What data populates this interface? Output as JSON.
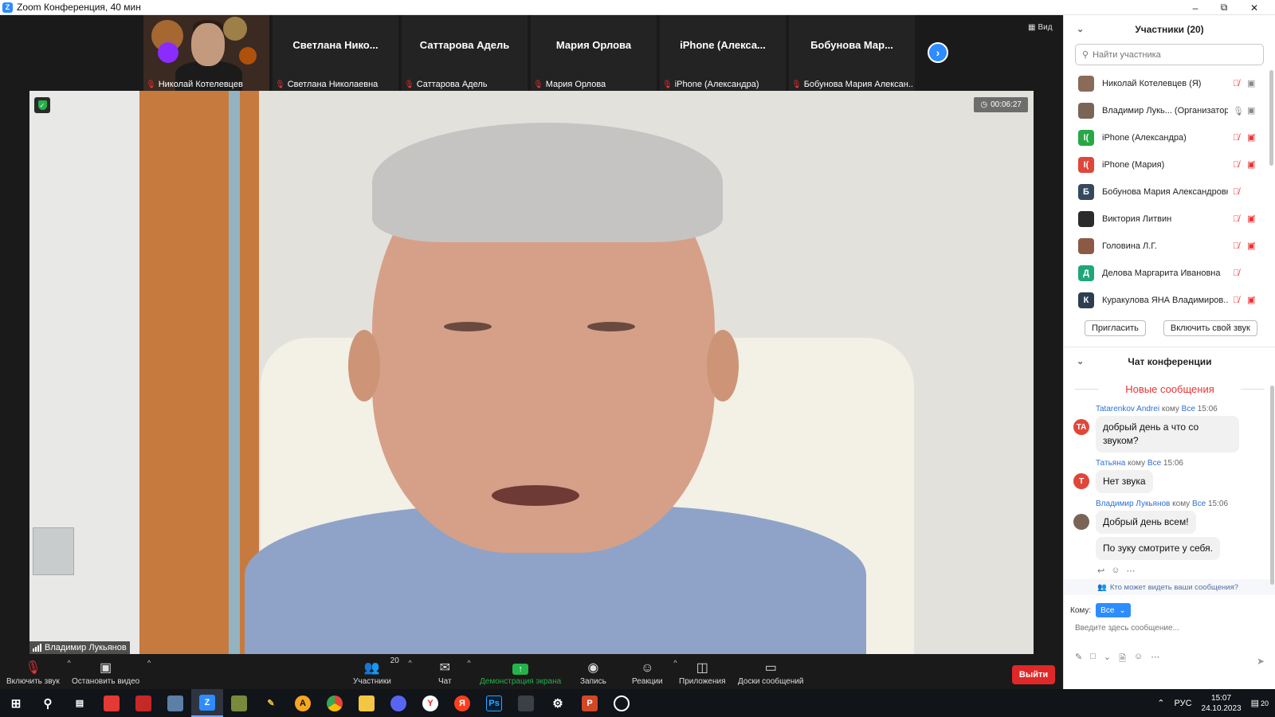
{
  "window": {
    "title": "Zoom Конференция, 40 мин",
    "logo_letter": "Z"
  },
  "thumbnails": [
    {
      "big_name": "",
      "name": "Николай Котелевцев",
      "self": true
    },
    {
      "big_name": "Светлана  Нико...",
      "name": "Светлана Николаевна"
    },
    {
      "big_name": "Саттарова Адель",
      "name": "Саттарова Адель"
    },
    {
      "big_name": "Мария Орлова",
      "name": "Мария Орлова"
    },
    {
      "big_name": "iPhone  (Алекса...",
      "name": "iPhone (Александра)"
    },
    {
      "big_name": "Бобунова  Мар...",
      "name": "Бобунова Мария Алексан..."
    }
  ],
  "view_label": "Вид",
  "main_video": {
    "timer": "00:06:27",
    "speaker": "Владимир Лукьянов"
  },
  "toolbar": {
    "unmute": "Включить звук",
    "stop_video": "Остановить видео",
    "participants": "Участники",
    "participants_count": "20",
    "chat": "Чат",
    "share": "Демонстрация экрана",
    "record": "Запись",
    "reactions": "Реакции",
    "apps": "Приложения",
    "whiteboards": "Доски сообщений",
    "leave": "Выйти"
  },
  "participants_panel": {
    "title": "Участники (20)",
    "search_placeholder": "Найти участника",
    "items": [
      {
        "name": "Николай Котелевцев (Я)",
        "avatar": "",
        "avatar_color": "#8a6a58",
        "mic": "muted",
        "cam": "on"
      },
      {
        "name": "Владимир Лукь... (Организатор)",
        "avatar": "",
        "avatar_color": "#7a6455",
        "mic": "on",
        "cam": "on"
      },
      {
        "name": "iPhone (Александра)",
        "avatar": "I(",
        "avatar_color": "#28a745",
        "mic": "muted",
        "cam": "off"
      },
      {
        "name": "iPhone (Мария)",
        "avatar": "I(",
        "avatar_color": "#e0463a",
        "mic": "muted",
        "cam": "off"
      },
      {
        "name": "Бобунова Мария Александровна",
        "avatar": "Б",
        "avatar_color": "#34495e",
        "mic": "muted",
        "cam": "none"
      },
      {
        "name": "Виктория Литвин",
        "avatar": "",
        "avatar_color": "#2b2b2b",
        "mic": "muted",
        "cam": "off"
      },
      {
        "name": "Головина Л.Г.",
        "avatar": "",
        "avatar_color": "#8c5a44",
        "mic": "muted",
        "cam": "off"
      },
      {
        "name": "Делова Маргарита Ивановна",
        "avatar": "Д",
        "avatar_color": "#1fa67a",
        "mic": "muted",
        "cam": "none"
      },
      {
        "name": "Куракулова ЯНА Владимиров...",
        "avatar": "К",
        "avatar_color": "#2c3e50",
        "mic": "muted",
        "cam": "off"
      }
    ],
    "invite": "Пригласить",
    "unmute_me": "Включить свой звук"
  },
  "chat_panel": {
    "title": "Чат конференции",
    "new_messages": "Новые сообщения",
    "to_word": "кому",
    "messages": [
      {
        "from": "Tatarenkov Andrei",
        "to": "Все",
        "time": "15:06",
        "avatar": "TA",
        "avatar_color": "#e0463a",
        "texts": [
          "добрый день а что со звуком?"
        ]
      },
      {
        "from": "Татьяна",
        "to": "Все",
        "time": "15:06",
        "avatar": "Т",
        "avatar_color": "#e0463a",
        "texts": [
          "Нет звука"
        ]
      },
      {
        "from": "Владимир Лукьянов",
        "to": "Все",
        "time": "15:06",
        "avatar": "",
        "avatar_color": "#7a6455",
        "texts": [
          "Добрый день всем!",
          "По зуку смотрите у себя."
        ]
      }
    ],
    "who_sees": "Кто может видеть ваши сообщения?",
    "to_label": "Кому:",
    "to_value": "Все",
    "input_placeholder": "Введите здесь сообщение..."
  },
  "taskbar": {
    "lang": "РУС",
    "time": "15:07",
    "date": "24.10.2023",
    "notifications": "20"
  }
}
